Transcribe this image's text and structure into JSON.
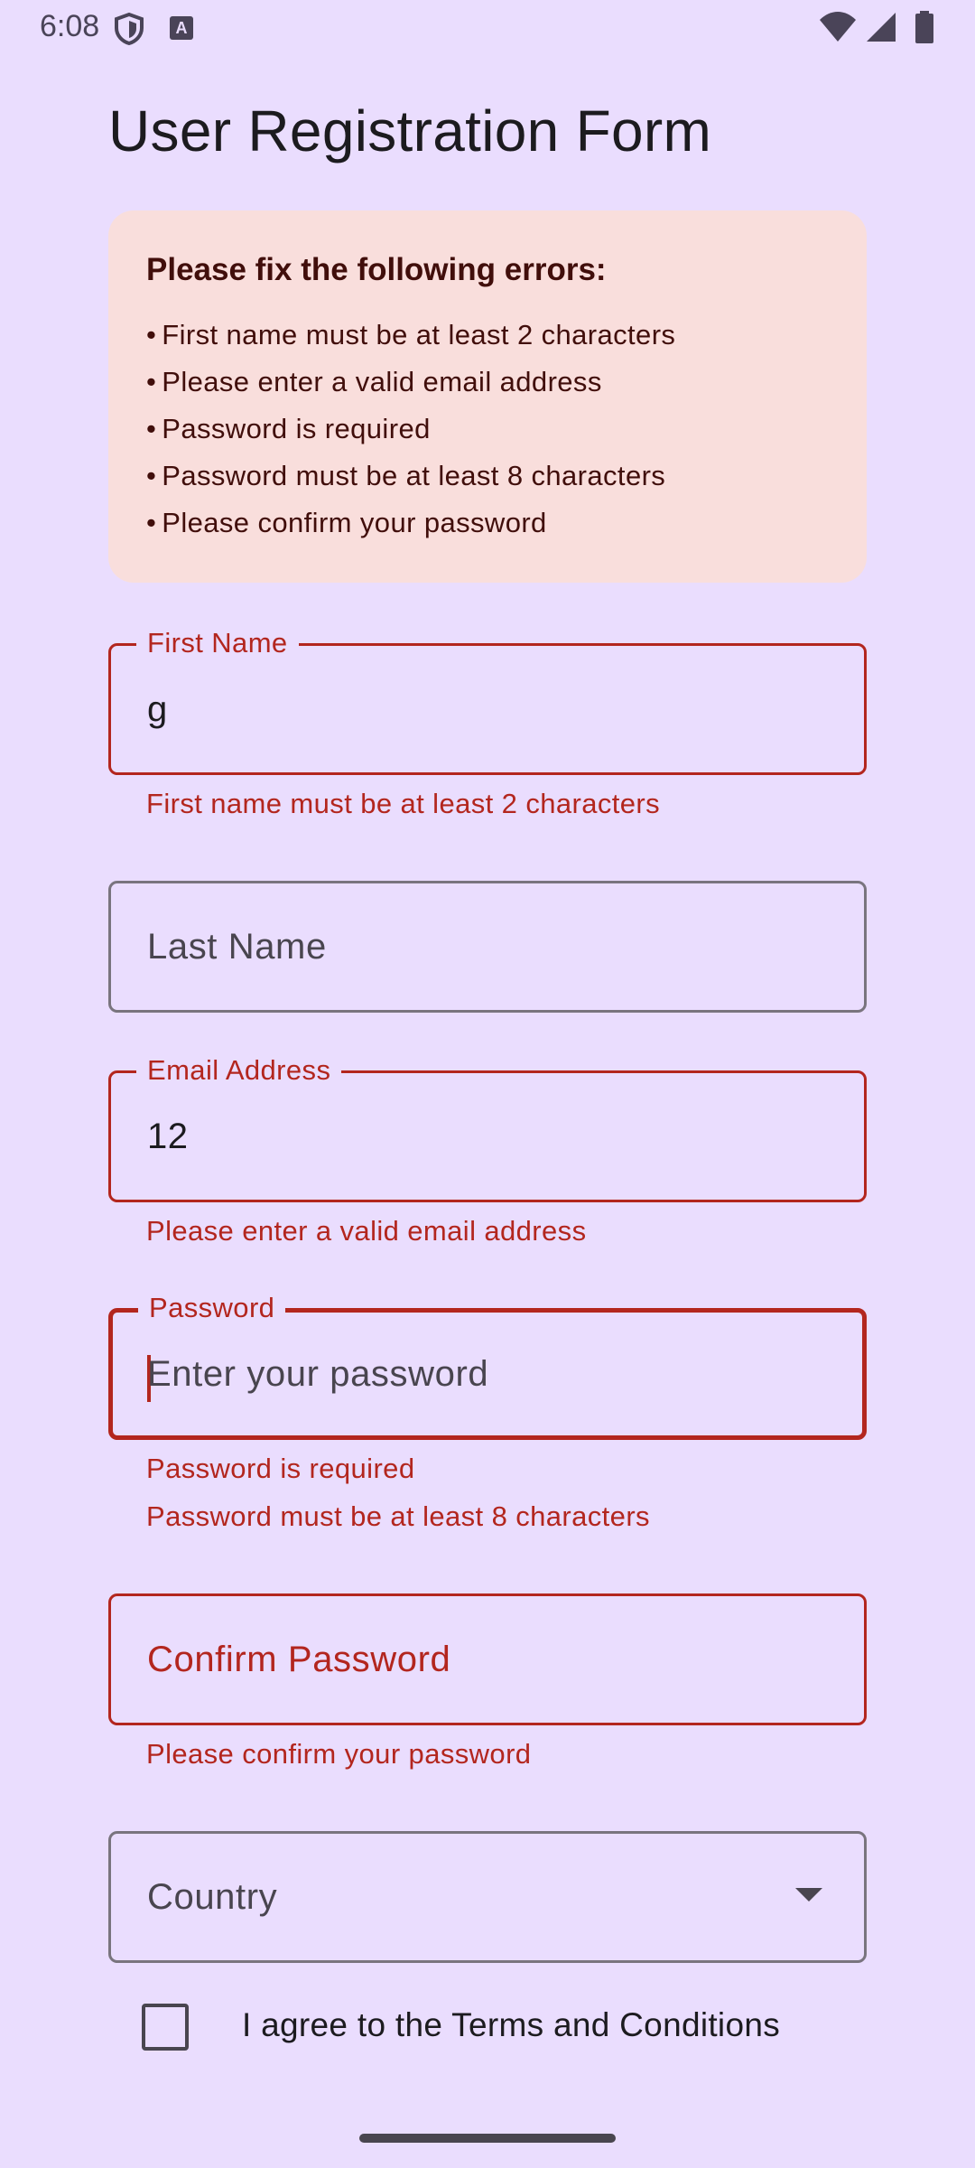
{
  "status_bar": {
    "time": "6:08",
    "icons": [
      "shield-icon",
      "font-a-icon",
      "wifi-icon",
      "signal-icon",
      "battery-icon"
    ]
  },
  "title": "User Registration Form",
  "error_summary": {
    "heading": "Please fix the following errors:",
    "items": [
      "First name must be at least 2 characters",
      "Please enter a valid email address",
      "Password is required",
      "Password must be at least 8 characters",
      "Please confirm your password"
    ]
  },
  "fields": {
    "first_name": {
      "label": "First Name",
      "value": "g",
      "error": "First name must be at least 2 characters"
    },
    "last_name": {
      "placeholder": "Last Name"
    },
    "email": {
      "label": "Email Address",
      "value": "12",
      "error": "Please enter a valid email address"
    },
    "password": {
      "label": "Password",
      "placeholder": "Enter your password",
      "errors": [
        "Password is required",
        "Password must be at least 8 characters"
      ]
    },
    "confirm_password": {
      "placeholder": "Confirm Password",
      "error": "Please confirm your password"
    },
    "country": {
      "placeholder": "Country"
    }
  },
  "terms": {
    "label": "I agree to the Terms and Conditions",
    "checked": false
  },
  "colors": {
    "background": "#EADDFE",
    "error": "#B3261E",
    "error_container": "#F9DEDC",
    "outline": "#79747E"
  }
}
